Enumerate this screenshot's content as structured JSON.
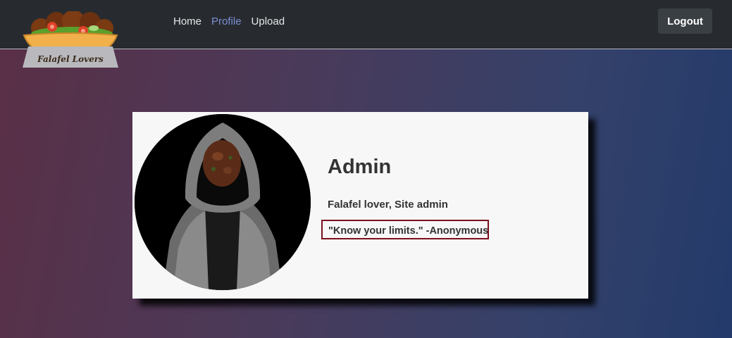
{
  "header": {
    "logo_text": "Falafel Lovers",
    "nav": {
      "home": "Home",
      "profile": "Profile",
      "upload": "Upload"
    },
    "active_nav": "Profile",
    "logout_label": "Logout"
  },
  "profile": {
    "name": "Admin",
    "description": "Falafel lover, Site admin",
    "quote": "\"Know your limits.\" -Anonymous"
  },
  "colors": {
    "navbar_bg": "#272b30",
    "active_link": "#7a8fd0",
    "quote_border": "#7a0f1e"
  }
}
